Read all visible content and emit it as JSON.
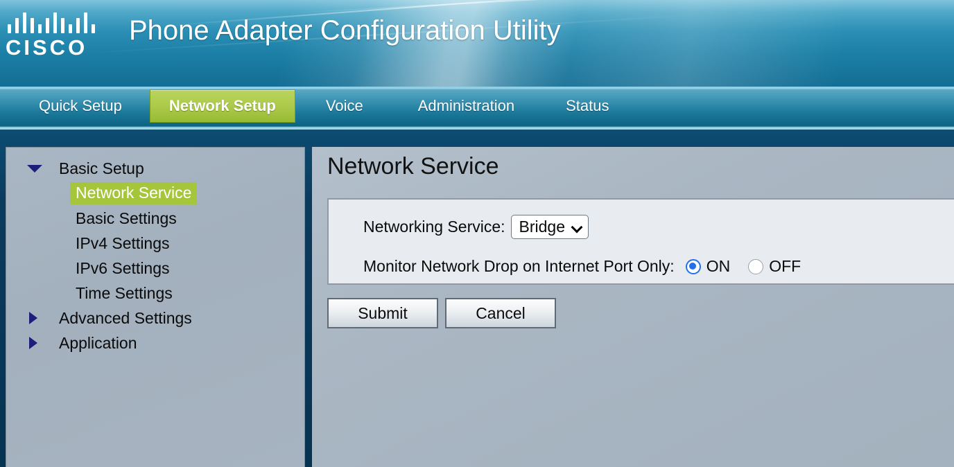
{
  "header": {
    "logo_icon": "cisco-logo",
    "logo_word": "CISCO",
    "app_title": "Phone Adapter Configuration Utility"
  },
  "nav": {
    "tabs": [
      {
        "label": "Quick Setup",
        "active": false
      },
      {
        "label": "Network Setup",
        "active": true
      },
      {
        "label": "Voice",
        "active": false
      },
      {
        "label": "Administration",
        "active": false
      },
      {
        "label": "Status",
        "active": false
      }
    ]
  },
  "sidebar": {
    "items": [
      {
        "label": "Basic Setup",
        "caret": "down",
        "level": 0,
        "selected": false
      },
      {
        "label": "Network Service",
        "caret": "none",
        "level": 1,
        "selected": true
      },
      {
        "label": "Basic Settings",
        "caret": "none",
        "level": 1,
        "selected": false
      },
      {
        "label": "IPv4 Settings",
        "caret": "none",
        "level": 1,
        "selected": false
      },
      {
        "label": "IPv6 Settings",
        "caret": "none",
        "level": 1,
        "selected": false
      },
      {
        "label": "Time Settings",
        "caret": "none",
        "level": 1,
        "selected": false
      },
      {
        "label": "Advanced Settings",
        "caret": "right",
        "level": 0,
        "selected": false
      },
      {
        "label": "Application",
        "caret": "right",
        "level": 0,
        "selected": false
      }
    ]
  },
  "main": {
    "title": "Network Service",
    "form": {
      "networking_service": {
        "label": "Networking Service:",
        "selected": "Bridge",
        "options": [
          "Bridge"
        ]
      },
      "monitor_network_drop": {
        "label": "Monitor Network Drop on Internet Port Only:",
        "selected": "ON",
        "options": [
          {
            "label": "ON",
            "checked": true
          },
          {
            "label": "OFF",
            "checked": false
          }
        ]
      }
    },
    "buttons": {
      "submit": "Submit",
      "cancel": "Cancel"
    }
  },
  "colors": {
    "accent_green": "#a5c63b",
    "header_blue": "#1c7fa6",
    "body_navy": "#0a3a5c",
    "panel_gray": "#a6b3c0",
    "form_bg": "#e8ecf1",
    "radio_blue": "#2070f0"
  }
}
